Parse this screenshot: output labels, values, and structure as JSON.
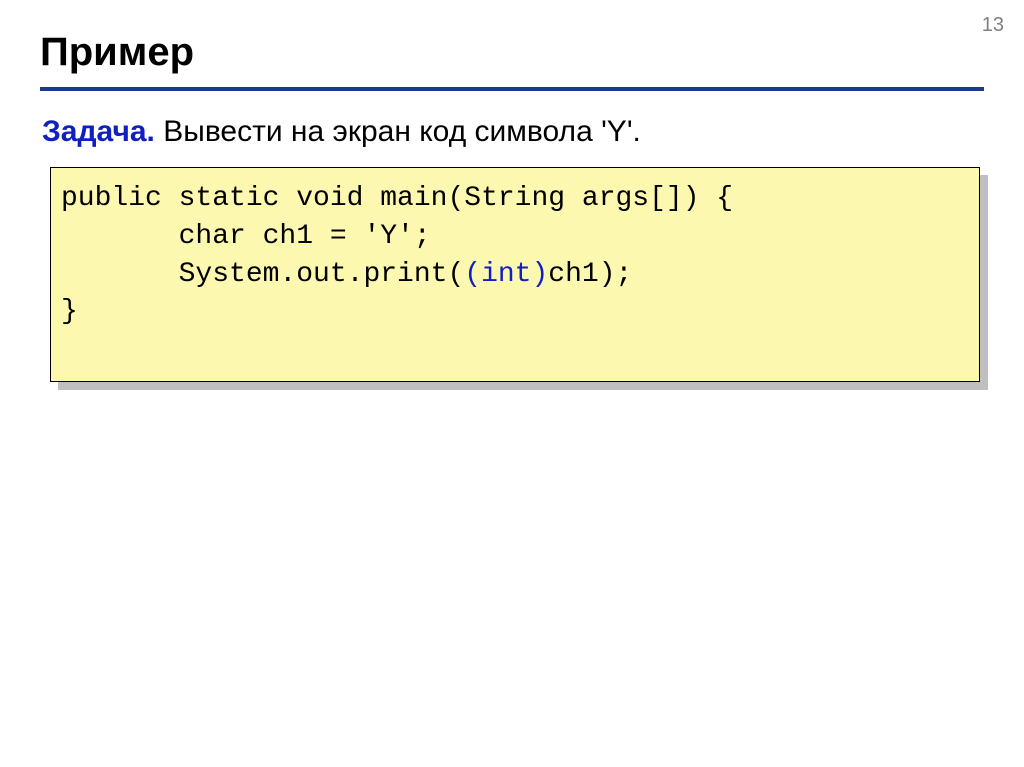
{
  "page_number": "13",
  "title": "Пример",
  "task": {
    "label": "Задача.",
    "text": " Вывести на экран код символа 'Y'."
  },
  "code": {
    "line1_a": "public static void main(String args[]) {",
    "line2": "       char ch1 = 'Y';",
    "line3_a": "       System.out.print(",
    "line3_b": "(int)",
    "line3_c": "ch1);",
    "line4": "}"
  }
}
